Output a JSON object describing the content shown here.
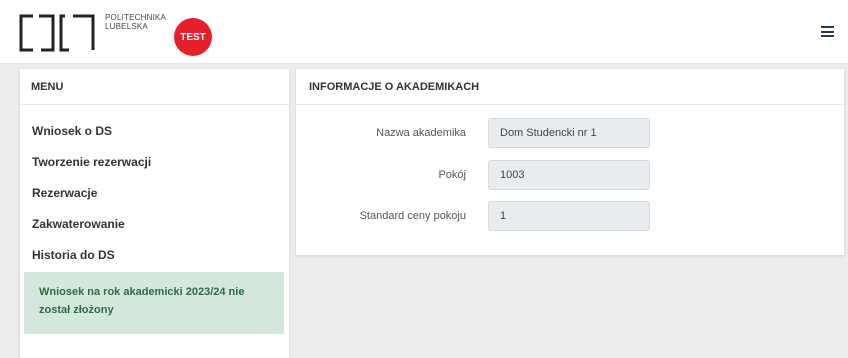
{
  "header": {
    "university_line1": "POLITECHNIKA",
    "university_line2": "LUBELSKA",
    "badge": "TEST",
    "menu_icon": "hamburger-menu-icon"
  },
  "sidebar": {
    "title": "MENU",
    "items": [
      {
        "label": "Wniosek o DS"
      },
      {
        "label": "Tworzenie rezerwacji"
      },
      {
        "label": "Rezerwacje"
      },
      {
        "label": "Zakwaterowanie"
      },
      {
        "label": "Historia do DS"
      }
    ],
    "notice": "Wniosek na rok akademicki 2023/24 nie został złożony"
  },
  "info": {
    "title": "INFORMACJE O AKADEMIKACH",
    "fields": [
      {
        "label": "Nazwa akademika",
        "value": "Dom Studencki nr 1"
      },
      {
        "label": "Pokój",
        "value": "1003"
      },
      {
        "label": "Standard ceny pokoju",
        "value": "1"
      }
    ]
  },
  "colors": {
    "badge": "#e5202a",
    "notice_bg": "#d3e7dd",
    "notice_text": "#2f6b47",
    "page_bg": "#ececec"
  }
}
